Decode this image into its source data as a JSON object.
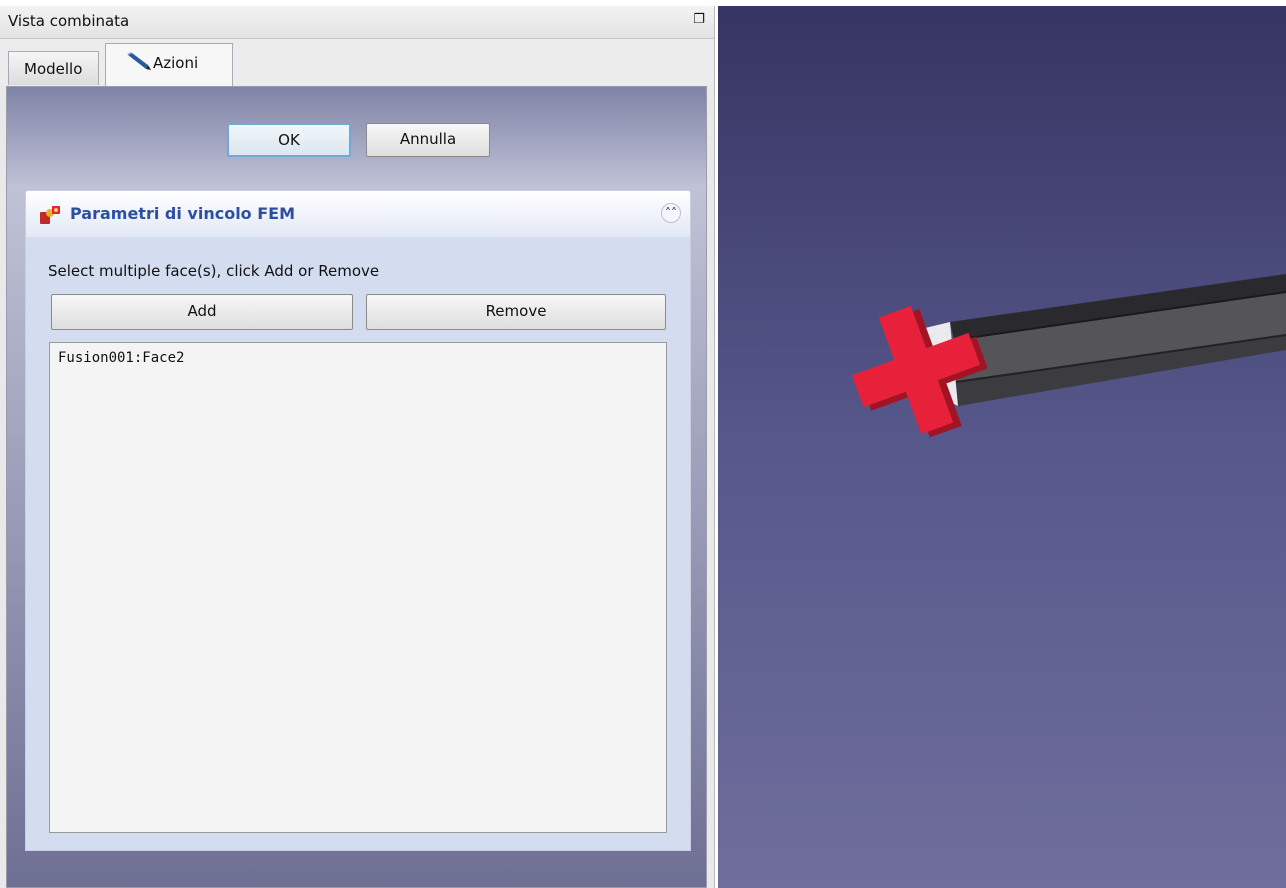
{
  "dock": {
    "title": "Vista combinata",
    "float_icon": "restore-window-icon"
  },
  "tabs": [
    {
      "label": "Modello",
      "active": false
    },
    {
      "label": "Azioni",
      "active": true,
      "icon": "pencil-icon"
    }
  ],
  "dialog": {
    "ok_label": "OK",
    "cancel_label": "Annulla"
  },
  "constraint_box": {
    "title": "Parametri di vincolo FEM",
    "icon": "fem-constraint-icon",
    "collapse_icon": "double-chevron-up-icon",
    "instructions": "Select multiple face(s), click Add or Remove",
    "add_label": "Add",
    "remove_label": "Remove",
    "references": [
      "Fusion001:Face2"
    ]
  },
  "viewport": {
    "background_top": "#363462",
    "background_bottom": "#6f6e9c",
    "constraint_marker_color": "#e8213b"
  }
}
